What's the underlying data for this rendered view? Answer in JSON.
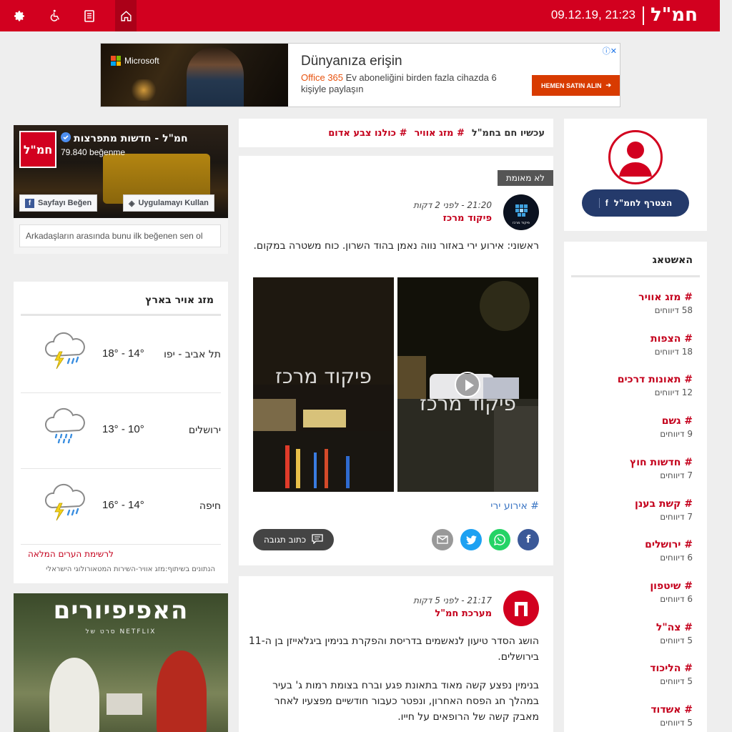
{
  "topbar": {
    "date": "09.12.19, 21:23",
    "logo": "חמ\"ל",
    "icons": [
      "gear-icon",
      "accessibility-icon",
      "tablet-icon",
      "home-icon"
    ]
  },
  "ad": {
    "brand": "Microsoft",
    "title": "Dünyanıza erişin",
    "product": "Office 365",
    "text_rest": " Ev aboneliğini birden fazla cihazda 6 kişiyle paylaşın",
    "cta": "HEMEN SATIN ALIN"
  },
  "join": {
    "label": "הצטרף לחמ\"ל",
    "fb": "f"
  },
  "hashtags": {
    "title": "האשטאג",
    "items": [
      {
        "name": "# מזג אוויר",
        "count": "58 דיווחים"
      },
      {
        "name": "# הצפות",
        "count": "18 דיווחים"
      },
      {
        "name": "# תאונות דרכים",
        "count": "12 דיווחים"
      },
      {
        "name": "# גשם",
        "count": "9 דיווחים"
      },
      {
        "name": "# חדשות חוץ",
        "count": "7 דיווחים"
      },
      {
        "name": "# קשת בענן",
        "count": "7 דיווחים"
      },
      {
        "name": "# ירושלים",
        "count": "6 דיווחים"
      },
      {
        "name": "# שיטפון",
        "count": "6 דיווחים"
      },
      {
        "name": "# צה\"ל",
        "count": "5 דיווחים"
      },
      {
        "name": "# הליכוד",
        "count": "5 דיווחים"
      },
      {
        "name": "# אשדוד",
        "count": "5 דיווחים"
      }
    ]
  },
  "now": {
    "label": "עכשיו חם בחמ\"ל",
    "tags": [
      "# מזג אוויר",
      "# כולנו צבע אדום"
    ]
  },
  "post1": {
    "badge": "לא מאומת",
    "time": "21:20 - לפני 2 דקות",
    "source": "פיקוד מרכז",
    "avatar_text": "פיקוד מרכז",
    "text": "ראשוני: אירוע ירי באזור נווה נאמן בהוד השרון. כוח משטרה במקום.",
    "watermark": "פיקוד מרכז",
    "hashtag": "# אירוע ירי",
    "comment": "כתוב תגובה"
  },
  "post2": {
    "time": "21:17 - לפני 5 דקות",
    "source": "מערכת חמ\"ל",
    "text1": "הושג הסדר טיעון לנאשמים בדריסת והפקרת בנימין ביגלאייזן בן ה-11 בירושלים.",
    "text2": "בנימין נפצע קשה מאוד בתאונת פגע וברח בצומת רמות ג' בעיר במהלך חג הפסח האחרון, ונפטר כעבור חודשיים מפצעיו לאחר מאבק קשה של הרופאים על חייו."
  },
  "fb": {
    "logo": "חמ\"ל",
    "name": "חמ\"ל - חדשות מתפרצות",
    "likes": "79.840 beğenme",
    "like_btn": "Sayfayı Beğen",
    "app_btn": "Uygulamayı Kullan",
    "friends": "Arkadaşların arasında bunu ilk beğenen sen ol"
  },
  "weather": {
    "title": "מזג אויר בארץ",
    "cities": [
      {
        "city": "תל אביב - יפו",
        "temp": "18° - 14°",
        "icon": "thunderstorm-rain-icon"
      },
      {
        "city": "ירושלים",
        "temp": "13° - 10°",
        "icon": "rain-cloud-icon"
      },
      {
        "city": "חיפה",
        "temp": "16° - 14°",
        "icon": "thunderstorm-rain-icon"
      }
    ],
    "link": "לרשימת הערים המלאה",
    "credit": "הנתונים בשיתוף:מזג אוויר-השירות המטאורולוגי הישראלי"
  },
  "netflix": {
    "title": "האפיפיורים",
    "sub": "NETFLIX סרט של"
  },
  "colors": {
    "brand_red": "#d2001f",
    "tag_red": "#c4001c",
    "link_blue": "#3d77c4",
    "join_navy": "#243a6b"
  }
}
